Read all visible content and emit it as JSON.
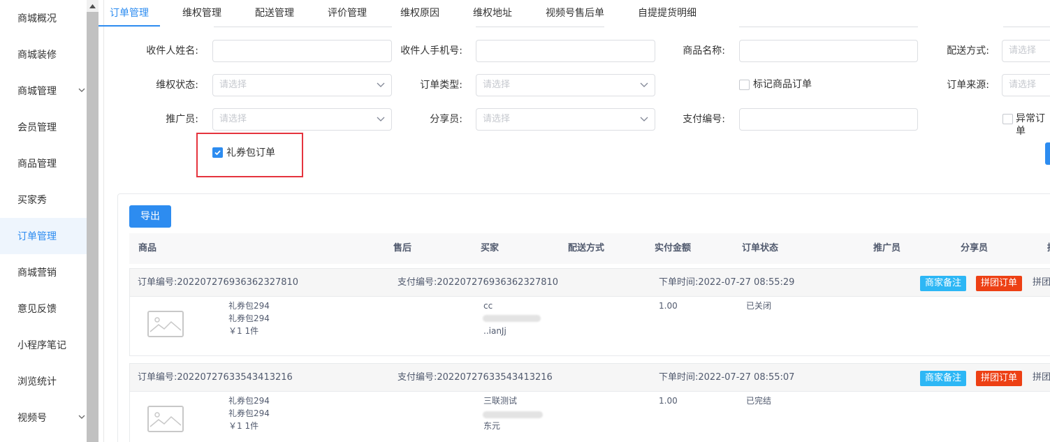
{
  "sidebar": {
    "items": [
      {
        "label": "商城概况",
        "expandable": false,
        "active": false
      },
      {
        "label": "商城装修",
        "expandable": false,
        "active": false
      },
      {
        "label": "商城管理",
        "expandable": true,
        "active": false
      },
      {
        "label": "会员管理",
        "expandable": false,
        "active": false
      },
      {
        "label": "商品管理",
        "expandable": false,
        "active": false
      },
      {
        "label": "买家秀",
        "expandable": false,
        "active": false
      },
      {
        "label": "订单管理",
        "expandable": false,
        "active": true
      },
      {
        "label": "商城营销",
        "expandable": false,
        "active": false
      },
      {
        "label": "意见反馈",
        "expandable": false,
        "active": false
      },
      {
        "label": "小程序笔记",
        "expandable": false,
        "active": false
      },
      {
        "label": "浏览统计",
        "expandable": false,
        "active": false
      },
      {
        "label": "视频号",
        "expandable": true,
        "active": false
      }
    ]
  },
  "tabs": [
    "订单管理",
    "维权管理",
    "配送管理",
    "评价管理",
    "维权原因",
    "维权地址",
    "视频号售后单",
    "自提提货明细"
  ],
  "filters": {
    "receiver_name": {
      "label": "收件人姓名:",
      "value": ""
    },
    "receiver_phone": {
      "label": "收件人手机号:",
      "value": ""
    },
    "goods_name": {
      "label": "商品名称:",
      "value": ""
    },
    "delivery_method": {
      "label": "配送方式:",
      "placeholder": "请选择"
    },
    "rights_status": {
      "label": "维权状态:",
      "placeholder": "请选择"
    },
    "order_type": {
      "label": "订单类型:",
      "placeholder": "请选择"
    },
    "mark_goods_order": {
      "label": "标记商品订单",
      "checked": false
    },
    "order_source": {
      "label": "订单来源:",
      "placeholder": "请选择"
    },
    "promoter": {
      "label": "推广员:",
      "placeholder": "请选择"
    },
    "sharer": {
      "label": "分享员:",
      "placeholder": "请选择"
    },
    "pay_no": {
      "label": "支付编号:",
      "value": ""
    },
    "abnormal_order": {
      "label": "异常订单",
      "checked": false
    },
    "gift_package_order": {
      "label": "礼券包订单",
      "checked": true
    }
  },
  "toolbar": {
    "export_label": "导出"
  },
  "table": {
    "columns": [
      "商品",
      "售后",
      "买家",
      "配送方式",
      "实付金额",
      "订单状态",
      "推广员",
      "分享员",
      "拼"
    ],
    "orders": [
      {
        "order_no": "订单编号:202207276936362327810",
        "pay_no": "支付编号:202207276936362327810",
        "time": "下单时间:2022-07-27 08:55:29",
        "remark_btn": "商家备注",
        "group_btn": "拼团订单",
        "extra": "拼团",
        "goods_lines": [
          "礼券包294",
          "礼券包294",
          "￥1   1件"
        ],
        "buyer_lines": [
          "cc",
          "",
          "..ianJj"
        ],
        "amount": "1.00",
        "status": "已关闭"
      },
      {
        "order_no": "订单编号:20220727633543413216",
        "pay_no": "支付编号:20220727633543413216",
        "time": "下单时间:2022-07-27 08:55:07",
        "remark_btn": "商家备注",
        "group_btn": "拼团订单",
        "extra": "拼团",
        "goods_lines": [
          "礼券包294",
          "礼券包294",
          "￥1   1件"
        ],
        "buyer_lines": [
          "三联测试",
          "",
          "东元"
        ],
        "amount": "1.00",
        "status": "已完结"
      }
    ]
  },
  "colors": {
    "accent": "#2d8cf0",
    "highlight": "#e5343e",
    "tag_blue": "#2db7f5",
    "tag_red": "#ed4014"
  }
}
